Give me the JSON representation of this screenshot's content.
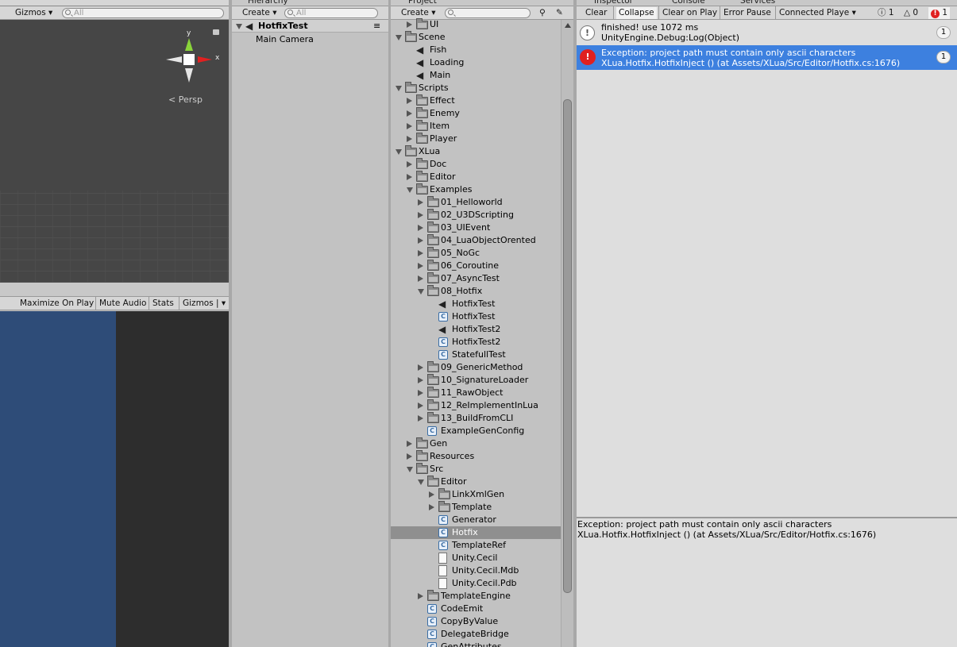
{
  "scene": {
    "gizmos_label": "Gizmos",
    "search_placeholder": "All",
    "persp_label": "Persp",
    "axis_y": "y",
    "axis_x": "x"
  },
  "game": {
    "maximize_label": "Maximize On Play",
    "mute_label": "Mute Audio",
    "stats_label": "Stats",
    "gizmos_label": "Gizmos"
  },
  "hierarchy": {
    "tab_label": "Hierarchy",
    "create_label": "Create",
    "search_placeholder": "All",
    "scene_name": "HotfixTest",
    "items": [
      "Main Camera"
    ]
  },
  "project": {
    "tab_label": "Project",
    "create_label": "Create",
    "search_placeholder": "",
    "tree": [
      {
        "label": "UI",
        "depth": 1,
        "icon": "folder",
        "state": "collapsed"
      },
      {
        "label": "Scene",
        "depth": 0,
        "icon": "folder",
        "state": "expanded"
      },
      {
        "label": "Fish",
        "depth": 1,
        "icon": "unity-scene",
        "state": "none"
      },
      {
        "label": "Loading",
        "depth": 1,
        "icon": "unity-scene",
        "state": "none"
      },
      {
        "label": "Main",
        "depth": 1,
        "icon": "unity-scene",
        "state": "none"
      },
      {
        "label": "Scripts",
        "depth": 0,
        "icon": "folder",
        "state": "expanded"
      },
      {
        "label": "Effect",
        "depth": 1,
        "icon": "folder",
        "state": "collapsed"
      },
      {
        "label": "Enemy",
        "depth": 1,
        "icon": "folder",
        "state": "collapsed"
      },
      {
        "label": "Item",
        "depth": 1,
        "icon": "folder",
        "state": "collapsed"
      },
      {
        "label": "Player",
        "depth": 1,
        "icon": "folder",
        "state": "collapsed"
      },
      {
        "label": "XLua",
        "depth": 0,
        "icon": "folder",
        "state": "expanded"
      },
      {
        "label": "Doc",
        "depth": 1,
        "icon": "folder",
        "state": "collapsed"
      },
      {
        "label": "Editor",
        "depth": 1,
        "icon": "folder",
        "state": "collapsed"
      },
      {
        "label": "Examples",
        "depth": 1,
        "icon": "folder",
        "state": "expanded"
      },
      {
        "label": "01_Helloworld",
        "depth": 2,
        "icon": "folder",
        "state": "collapsed"
      },
      {
        "label": "02_U3DScripting",
        "depth": 2,
        "icon": "folder",
        "state": "collapsed"
      },
      {
        "label": "03_UIEvent",
        "depth": 2,
        "icon": "folder",
        "state": "collapsed"
      },
      {
        "label": "04_LuaObjectOrented",
        "depth": 2,
        "icon": "folder",
        "state": "collapsed"
      },
      {
        "label": "05_NoGc",
        "depth": 2,
        "icon": "folder",
        "state": "collapsed"
      },
      {
        "label": "06_Coroutine",
        "depth": 2,
        "icon": "folder",
        "state": "collapsed"
      },
      {
        "label": "07_AsyncTest",
        "depth": 2,
        "icon": "folder",
        "state": "collapsed"
      },
      {
        "label": "08_Hotfix",
        "depth": 2,
        "icon": "folder",
        "state": "expanded"
      },
      {
        "label": "HotfixTest",
        "depth": 3,
        "icon": "unity-scene",
        "state": "none"
      },
      {
        "label": "HotfixTest",
        "depth": 3,
        "icon": "cs-script",
        "state": "none"
      },
      {
        "label": "HotfixTest2",
        "depth": 3,
        "icon": "unity-scene",
        "state": "none"
      },
      {
        "label": "HotfixTest2",
        "depth": 3,
        "icon": "cs-script",
        "state": "none"
      },
      {
        "label": "StatefullTest",
        "depth": 3,
        "icon": "cs-script",
        "state": "none"
      },
      {
        "label": "09_GenericMethod",
        "depth": 2,
        "icon": "folder",
        "state": "collapsed"
      },
      {
        "label": "10_SignatureLoader",
        "depth": 2,
        "icon": "folder",
        "state": "collapsed"
      },
      {
        "label": "11_RawObject",
        "depth": 2,
        "icon": "folder",
        "state": "collapsed"
      },
      {
        "label": "12_ReImplementInLua",
        "depth": 2,
        "icon": "folder",
        "state": "collapsed"
      },
      {
        "label": "13_BuildFromCLI",
        "depth": 2,
        "icon": "folder",
        "state": "collapsed"
      },
      {
        "label": "ExampleGenConfig",
        "depth": 2,
        "icon": "cs-script",
        "state": "none"
      },
      {
        "label": "Gen",
        "depth": 1,
        "icon": "folder",
        "state": "collapsed"
      },
      {
        "label": "Resources",
        "depth": 1,
        "icon": "folder",
        "state": "collapsed"
      },
      {
        "label": "Src",
        "depth": 1,
        "icon": "folder",
        "state": "expanded"
      },
      {
        "label": "Editor",
        "depth": 2,
        "icon": "folder",
        "state": "expanded"
      },
      {
        "label": "LinkXmlGen",
        "depth": 3,
        "icon": "folder",
        "state": "collapsed"
      },
      {
        "label": "Template",
        "depth": 3,
        "icon": "folder",
        "state": "collapsed"
      },
      {
        "label": "Generator",
        "depth": 3,
        "icon": "cs-script",
        "state": "none"
      },
      {
        "label": "Hotfix",
        "depth": 3,
        "icon": "cs-script",
        "state": "selected"
      },
      {
        "label": "TemplateRef",
        "depth": 3,
        "icon": "cs-script",
        "state": "none"
      },
      {
        "label": "Unity.Cecil",
        "depth": 3,
        "icon": "document",
        "state": "none"
      },
      {
        "label": "Unity.Cecil.Mdb",
        "depth": 3,
        "icon": "document",
        "state": "none"
      },
      {
        "label": "Unity.Cecil.Pdb",
        "depth": 3,
        "icon": "document",
        "state": "none"
      },
      {
        "label": "TemplateEngine",
        "depth": 2,
        "icon": "folder",
        "state": "collapsed"
      },
      {
        "label": "CodeEmit",
        "depth": 2,
        "icon": "cs-script",
        "state": "none"
      },
      {
        "label": "CopyByValue",
        "depth": 2,
        "icon": "cs-script",
        "state": "none"
      },
      {
        "label": "DelegateBridge",
        "depth": 2,
        "icon": "cs-script",
        "state": "none"
      },
      {
        "label": "GenAttributes",
        "depth": 2,
        "icon": "cs-script",
        "state": "none"
      }
    ]
  },
  "tabs": {
    "inspector": "Inspector",
    "console": "Console",
    "services": "Services"
  },
  "console": {
    "clear": "Clear",
    "collapse": "Collapse",
    "clear_on_play": "Clear on Play",
    "error_pause": "Error Pause",
    "connected_player": "Connected Playe",
    "warn_count": "1",
    "info_count": "0",
    "error_count": "1",
    "entries": [
      {
        "line1": "finished! use 1072 ms",
        "line2": "UnityEngine.Debug:Log(Object)",
        "count": "1",
        "type": "info"
      },
      {
        "line1": "Exception: project path must contain only ascii characters",
        "line2": "XLua.Hotfix.HotfixInject () (at Assets/XLua/Src/Editor/Hotfix.cs:1676)",
        "count": "1",
        "type": "error"
      }
    ],
    "detail_line1": "Exception: project path must contain only ascii characters",
    "detail_line2": "XLua.Hotfix.HotfixInject () (at Assets/XLua/Src/Editor/Hotfix.cs:1676)"
  },
  "colors": {
    "selection": "#3d80df",
    "error": "#e02020",
    "game_view_blue": "#2e4c78"
  }
}
